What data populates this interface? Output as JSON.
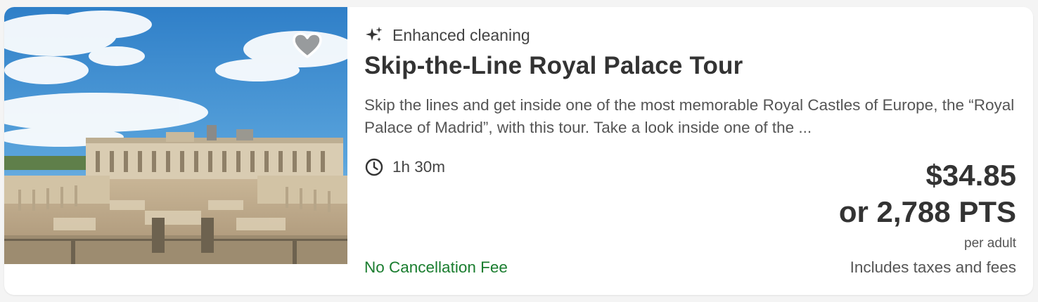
{
  "listing": {
    "image_alt": "Royal Palace of Madrid",
    "favorite_icon": "heart-icon",
    "badge": {
      "icon": "sparkle-icon",
      "label": "Enhanced cleaning"
    },
    "title": "Skip-the-Line Royal Palace Tour",
    "description": "Skip the lines and get inside one of the most memorable Royal Castles of Europe, the “Royal Palace of Madrid”, with this tour. Take a look inside one of the ...",
    "duration": {
      "icon": "clock-icon",
      "label": "1h 30m"
    },
    "price": "$34.85",
    "points": "or 2,788 PTS",
    "price_unit": "per adult",
    "cancellation": "No Cancellation Fee",
    "taxes_note": "Includes taxes and fees"
  },
  "colors": {
    "accent_green": "#1a7d2f",
    "text_dark": "#333333",
    "text_muted": "#555555"
  }
}
